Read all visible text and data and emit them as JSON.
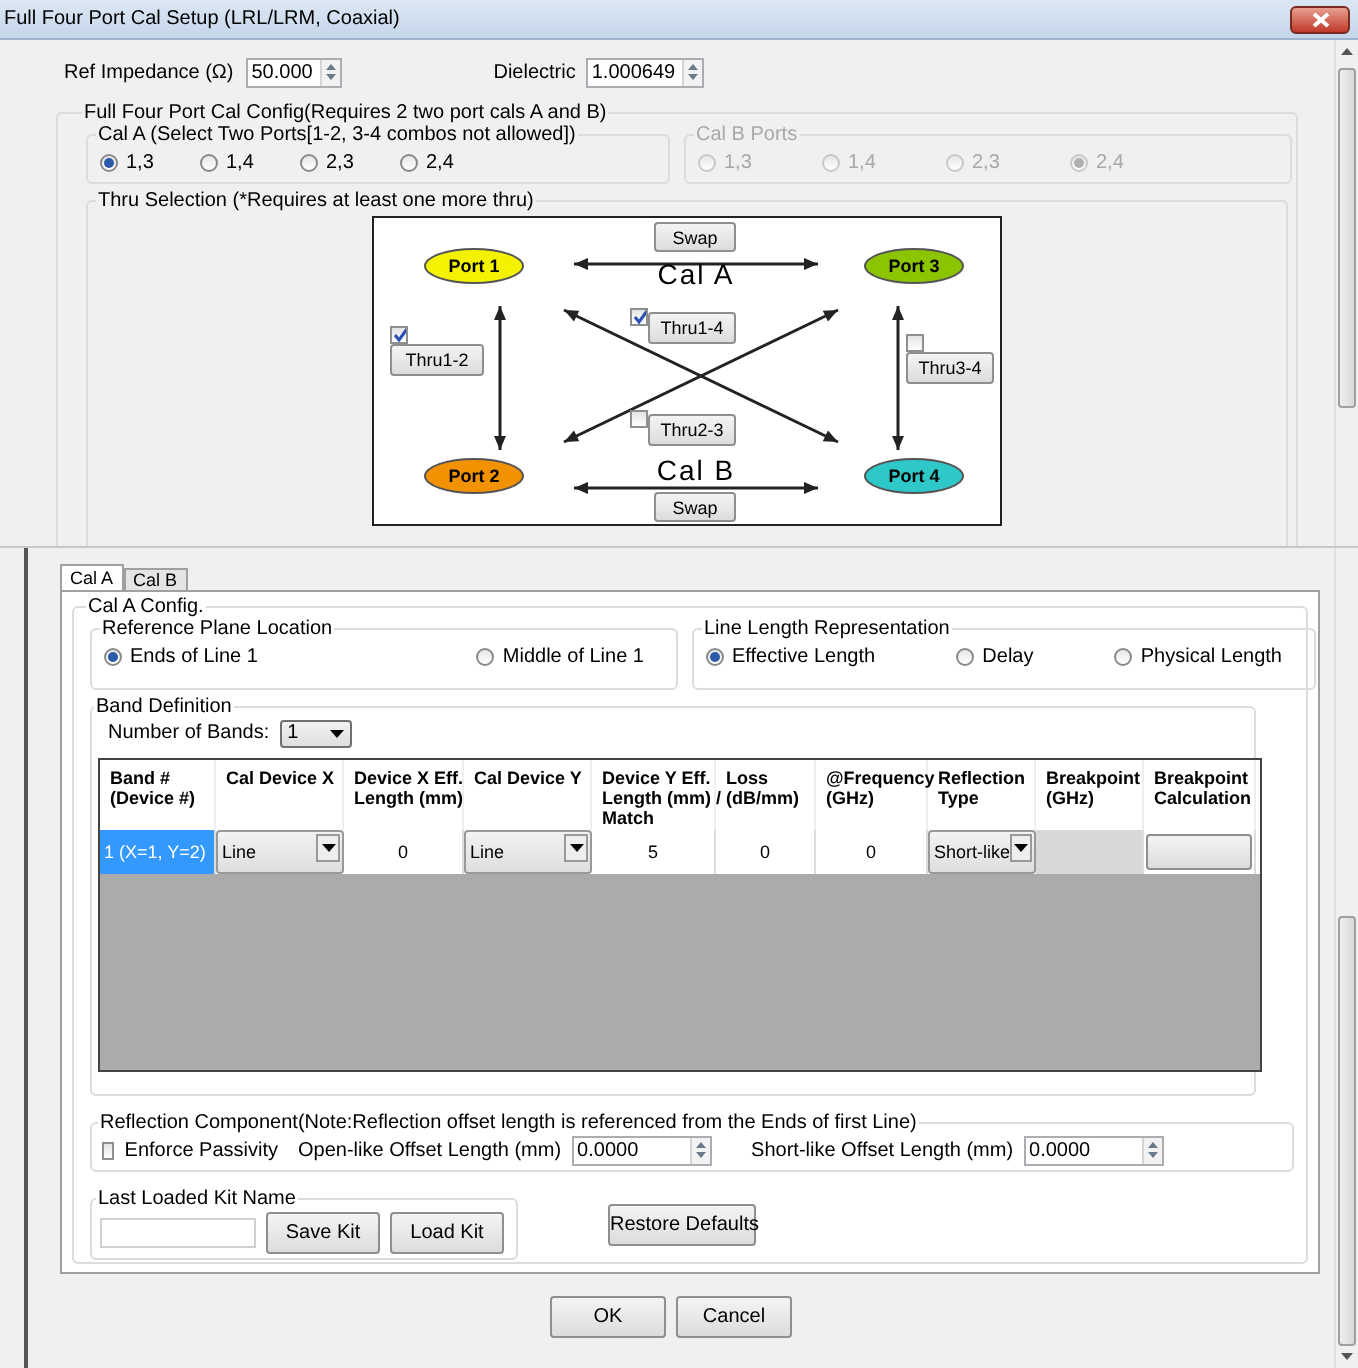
{
  "window": {
    "title": "Full Four Port Cal Setup (LRL/LRM, Coaxial)"
  },
  "ref_impedance": {
    "label": "Ref Impedance (Ω)",
    "value": "50.000"
  },
  "dielectric": {
    "label": "Dielectric",
    "value": "1.000649"
  },
  "config": {
    "title": "Full Four Port Cal Config(Requires 2 two port cals A and B)",
    "cal_a": {
      "title": "Cal A (Select Two Ports[1-2, 3-4 combos not allowed])",
      "disabled": false,
      "options": [
        {
          "label": "1,3",
          "selected": true
        },
        {
          "label": "1,4",
          "selected": false
        },
        {
          "label": "2,3",
          "selected": false
        },
        {
          "label": "2,4",
          "selected": false
        }
      ]
    },
    "cal_b": {
      "title": "Cal B Ports",
      "disabled": true,
      "options": [
        {
          "label": "1,3",
          "selected": false
        },
        {
          "label": "1,4",
          "selected": false
        },
        {
          "label": "2,3",
          "selected": false
        },
        {
          "label": "2,4",
          "selected": true
        }
      ]
    }
  },
  "thru": {
    "title": "Thru Selection (*Requires at least one more thru)",
    "ports": [
      {
        "label": "Port 1",
        "color": "#f5f200"
      },
      {
        "label": "Port 3",
        "color": "#8cc400"
      },
      {
        "label": "Port 2",
        "color": "#f39200"
      },
      {
        "label": "Port 4",
        "color": "#2ec8c8"
      }
    ],
    "cal_labels": [
      "Cal A",
      "Cal B"
    ],
    "swap_buttons": [
      "Swap",
      "Swap"
    ],
    "thrus": [
      {
        "label": "Thru1-2",
        "checked": true
      },
      {
        "label": "Thru1-4",
        "checked": true
      },
      {
        "label": "Thru2-3",
        "checked": false
      },
      {
        "label": "Thru3-4",
        "checked": false
      }
    ]
  },
  "tabs": [
    {
      "label": "Cal A",
      "selected": true
    },
    {
      "label": "Cal B",
      "selected": false
    }
  ],
  "cal_config": {
    "title": "Cal A Config.",
    "reference_plane": {
      "title": "Reference Plane Location",
      "options": [
        {
          "label": "Ends of Line 1",
          "selected": true
        },
        {
          "label": "Middle of Line 1",
          "selected": false
        }
      ]
    },
    "line_length": {
      "title": "Line Length Representation",
      "options": [
        {
          "label": "Effective Length",
          "selected": true
        },
        {
          "label": "Delay",
          "selected": false
        },
        {
          "label": "Physical Length",
          "selected": false
        }
      ]
    },
    "band": {
      "title": "Band Definition",
      "bands_label": "Number of Bands:",
      "bands_value": "1",
      "table": {
        "columns": [
          "Band #\n(Device #)",
          "Cal Device X",
          "Device X Eff.\nLength (mm)",
          "Cal Device Y",
          "Device Y Eff.\nLength (mm) /\nMatch",
          "Loss\n(dB/mm)",
          "@Frequency\n(GHz)",
          "Reflection\nType",
          "Breakpoint\n(GHz)",
          "Breakpoint\nCalculation"
        ],
        "rows": [
          {
            "selected": true,
            "cells": [
              {
                "kind": "text",
                "value": "1 (X=1, Y=2)"
              },
              {
                "kind": "dropdown",
                "value": "Line"
              },
              {
                "kind": "number",
                "value": "0"
              },
              {
                "kind": "dropdown",
                "value": "Line"
              },
              {
                "kind": "number",
                "value": "5"
              },
              {
                "kind": "number",
                "value": "0"
              },
              {
                "kind": "number",
                "value": "0"
              },
              {
                "kind": "dropdown",
                "value": "Short-like"
              },
              {
                "kind": "disabled"
              },
              {
                "kind": "button"
              }
            ]
          }
        ]
      }
    },
    "reflection": {
      "title": "Reflection Component(Note:Reflection offset length is referenced from the Ends of first Line)",
      "enforce": {
        "label": "Enforce Passivity",
        "checked": false
      },
      "open_label": "Open-like Offset Length (mm)",
      "open_value": "0.0000",
      "short_label": "Short-like Offset Length (mm)",
      "short_value": "0.0000"
    },
    "kit": {
      "title": "Last Loaded Kit Name",
      "buttons": [
        "Save Kit",
        "Load Kit"
      ]
    },
    "restore_button": "Restore Defaults"
  },
  "buttons": [
    "OK",
    "Cancel"
  ]
}
